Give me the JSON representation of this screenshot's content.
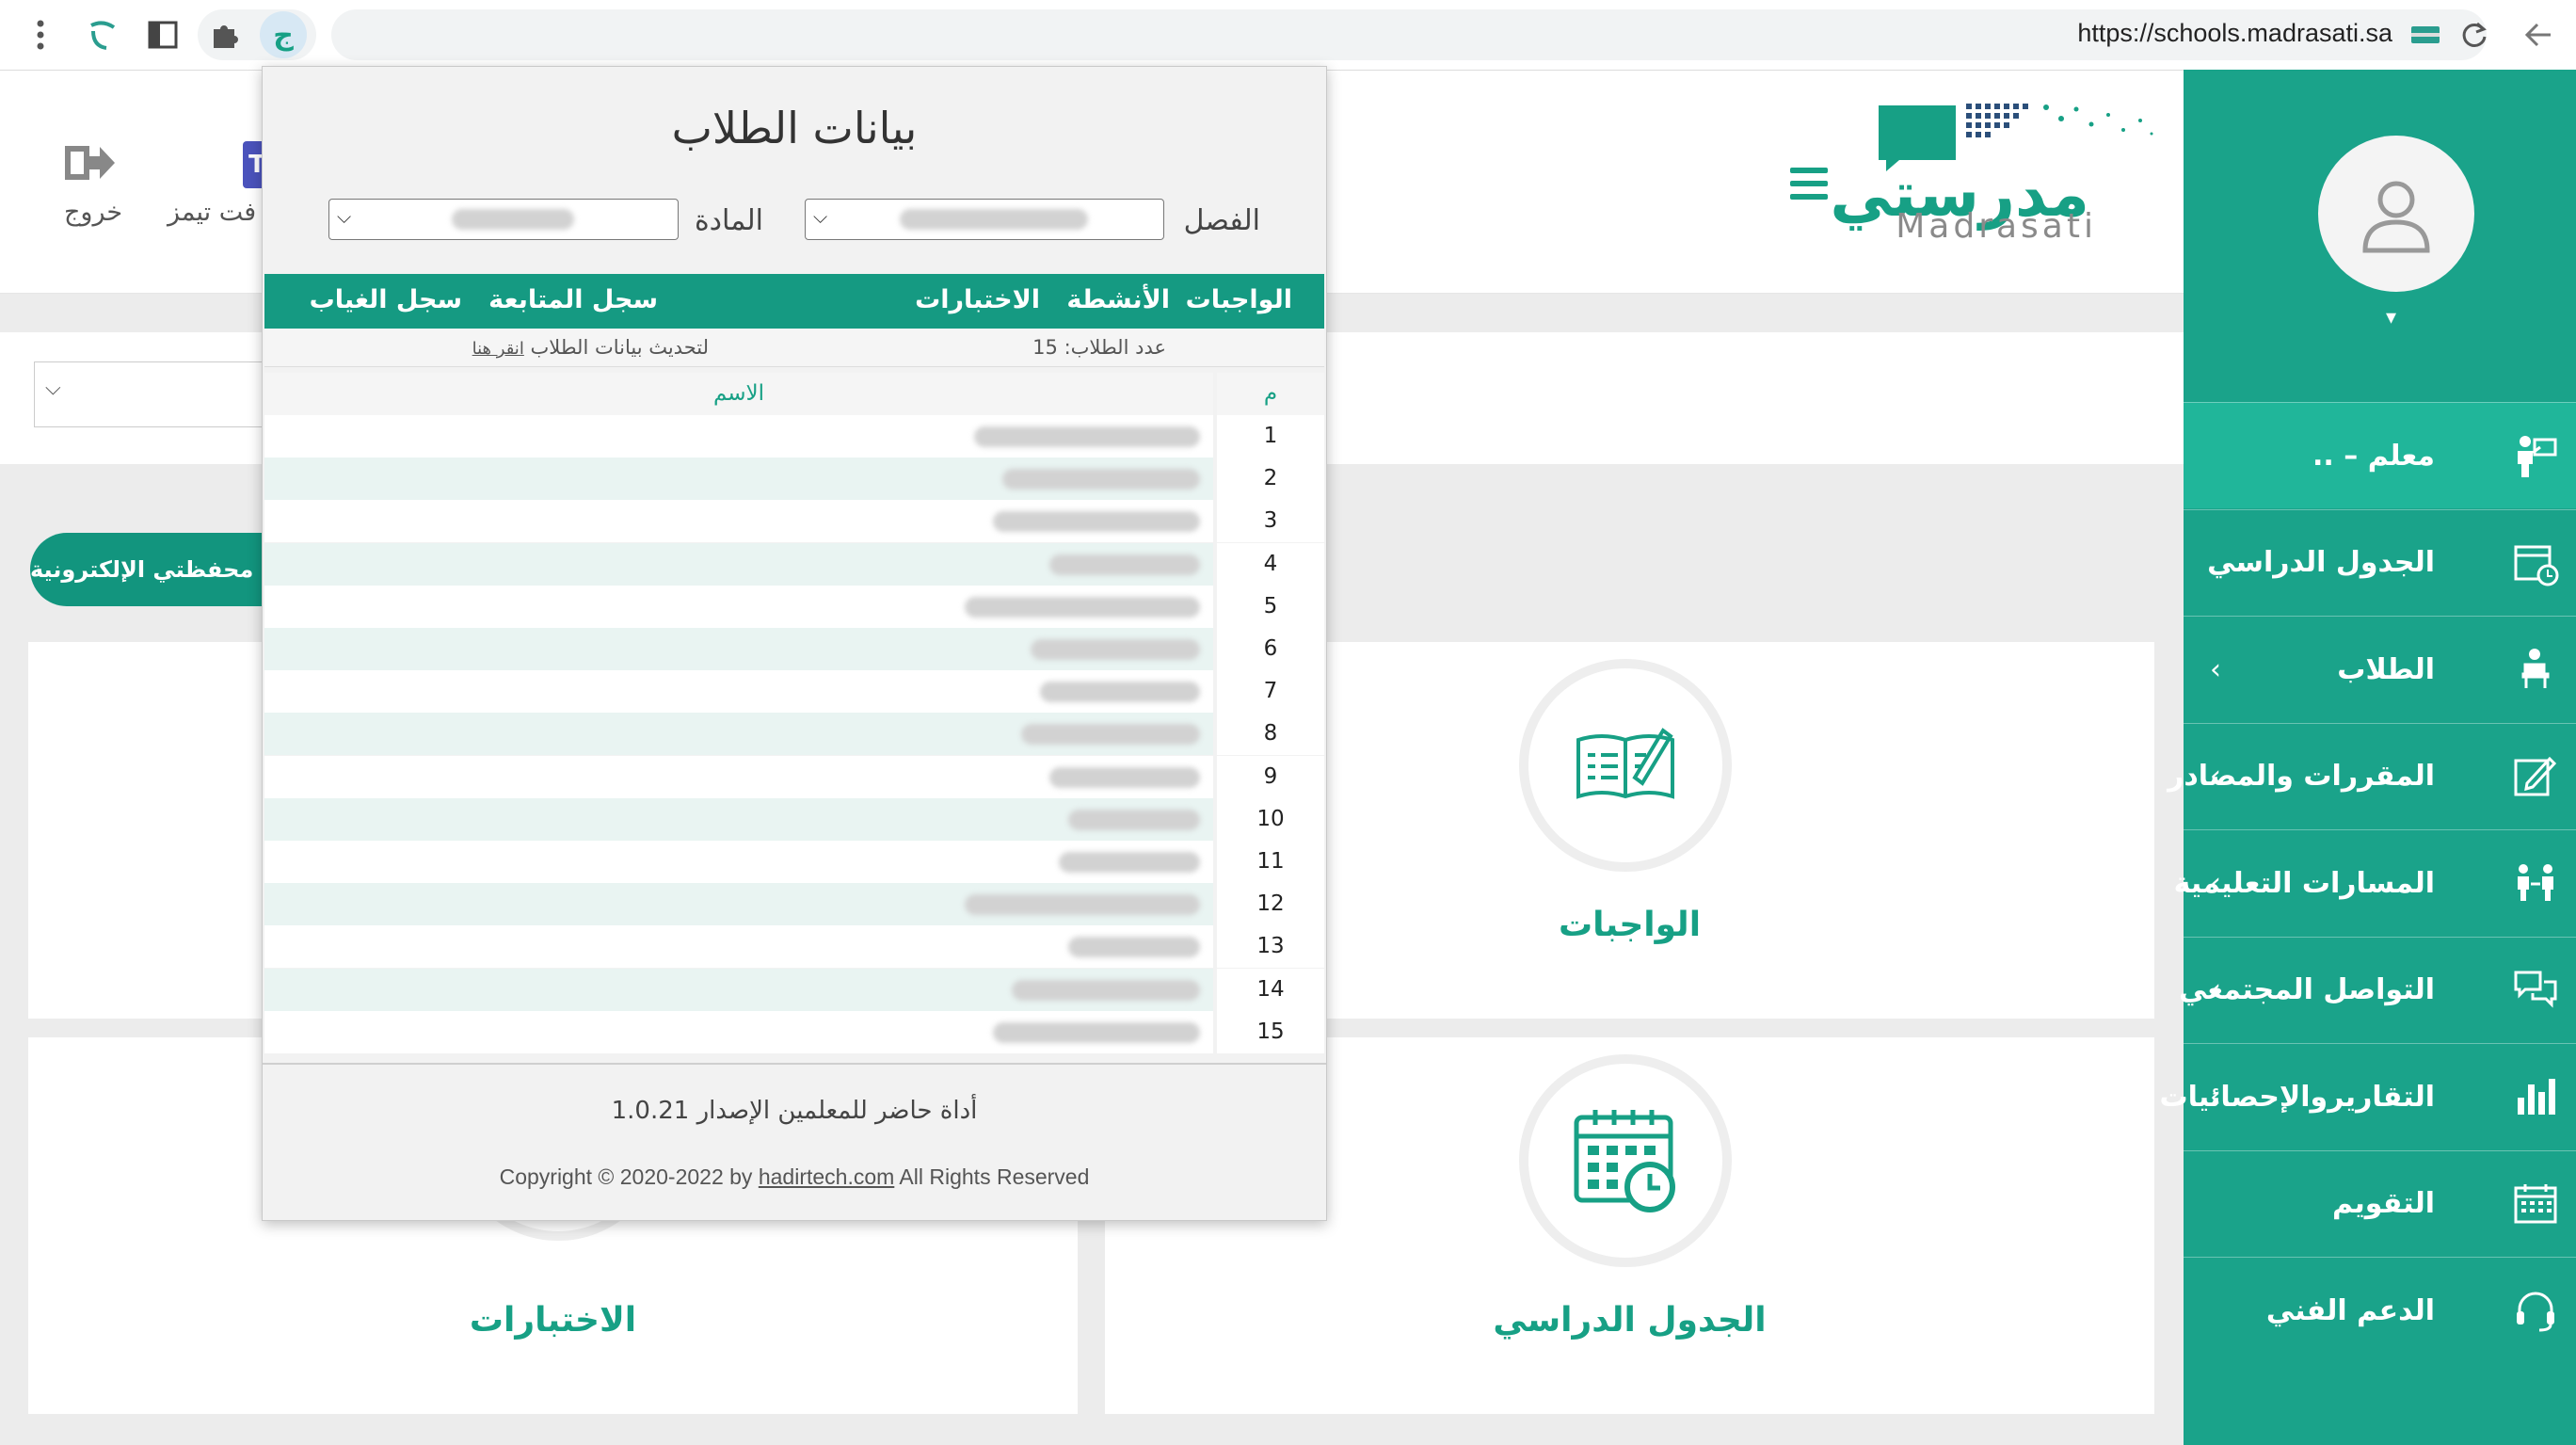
{
  "browser": {
    "url": "https://schools.madrasati.sa",
    "icons": [
      "more-vert-icon",
      "madrasati-ext-icon",
      "side-panel-icon",
      "extensions-puzzle-icon",
      "hadir-ext-icon",
      "reload-icon",
      "back-arrow-icon"
    ]
  },
  "site": {
    "logo_ar": "مدرستي",
    "logo_en": "Madrasati",
    "logout_label": "خروج",
    "teams_label": "فت تيمز",
    "teams_icon_letter": "T",
    "eportfolio_button": "محفظتي الإلكترونية"
  },
  "sidebar": {
    "items": [
      {
        "label": "معلم – ..",
        "icon": "teacher-icon",
        "active": true,
        "chevron": false
      },
      {
        "label": "الجدول الدراسي",
        "icon": "schedule-calendar-icon",
        "active": false,
        "chevron": false
      },
      {
        "label": "الطلاب",
        "icon": "students-icon",
        "active": false,
        "chevron": true
      },
      {
        "label": "المقررات والمصادر",
        "icon": "courses-edit-icon",
        "active": false,
        "chevron": true
      },
      {
        "label": "المسارات التعليمية",
        "icon": "learning-paths-icon",
        "active": false,
        "chevron": true
      },
      {
        "label": "التواصل المجتمعي",
        "icon": "chat-bubbles-icon",
        "active": false,
        "chevron": true
      },
      {
        "label": "التقاريروالإحصائيات",
        "icon": "bar-chart-icon",
        "active": false,
        "chevron": true
      },
      {
        "label": "التقويم",
        "icon": "calendar-grid-icon",
        "active": false,
        "chevron": false
      },
      {
        "label": "الدعم الفني",
        "icon": "headset-icon",
        "active": false,
        "chevron": false
      }
    ]
  },
  "cards": {
    "homework": "الواجبات",
    "schedule": "الجدول الدراسي",
    "exams": "الاختبارات"
  },
  "popup": {
    "title": "بيانات الطلاب",
    "class_label": "الفصل",
    "subject_label": "المادة",
    "nav": {
      "homework": "الواجبات",
      "activities": "الأنشطة",
      "exams": "الاختبارات",
      "followup": "سجل المتابعة",
      "absence": "سجل الغياب"
    },
    "student_count_text": "عدد الطلاب: 15",
    "refresh_prefix": "لتحديث بيانات الطلاب",
    "refresh_link": "انقر هنا",
    "table": {
      "col_num": "م",
      "col_name": "الاسم",
      "rows": [
        "1",
        "2",
        "3",
        "4",
        "5",
        "6",
        "7",
        "8",
        "9",
        "10",
        "11",
        "12",
        "13",
        "14",
        "15"
      ]
    },
    "version_text": "أداة حاضر للمعلمين الإصدار 1.0.21",
    "copyright_prefix": "Copyright © 2020-2022 by",
    "copyright_link": "hadirtech.com",
    "copyright_suffix": "All Rights Reserved"
  },
  "colors": {
    "brand": "#1aa38a",
    "brand_dark": "#159a82",
    "row_stripe": "#e9f4f2"
  }
}
